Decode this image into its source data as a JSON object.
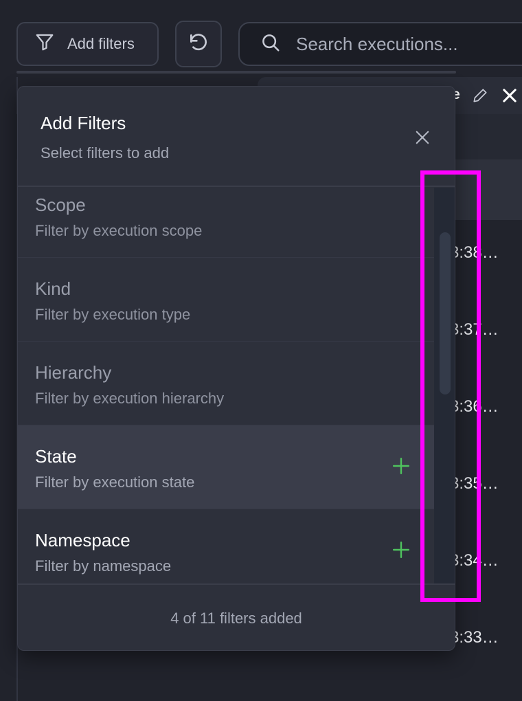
{
  "toolbar": {
    "add_filters_label": "Add filters",
    "search_placeholder": "Search executions..."
  },
  "table": {
    "column_header_fragment": "re",
    "row_times": [
      "3:38…",
      "3:37…",
      "3:36…",
      "3:35…",
      "3:34…",
      "3:33…"
    ]
  },
  "filter_panel": {
    "title": "Add Filters",
    "subtitle": "Select filters to add",
    "items": [
      {
        "name": "Scope",
        "description": "Filter by execution scope",
        "state": "added"
      },
      {
        "name": "Kind",
        "description": "Filter by execution type",
        "state": "added"
      },
      {
        "name": "Hierarchy",
        "description": "Filter by execution hierarchy",
        "state": "added"
      },
      {
        "name": "State",
        "description": "Filter by execution state",
        "state": "available"
      },
      {
        "name": "Namespace",
        "description": "Filter by namespace",
        "state": "available"
      }
    ],
    "footer": "4 of 11 filters added"
  },
  "colors": {
    "accent_add": "#4fc35e",
    "highlight": "#ff00ff",
    "background": "#21232c",
    "panel": "#2d303b"
  }
}
